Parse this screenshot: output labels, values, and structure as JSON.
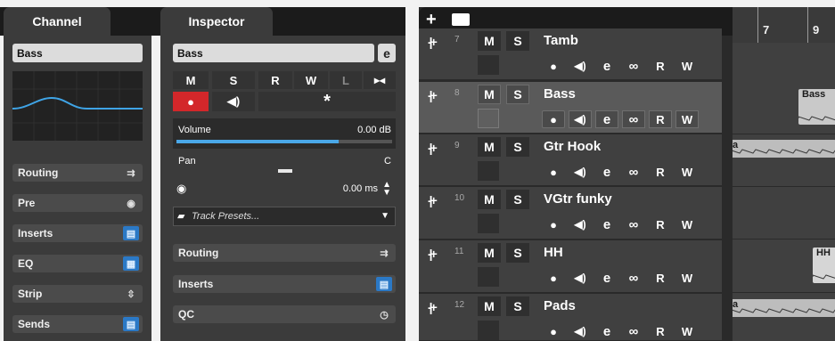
{
  "channel": {
    "tab_label": "Channel",
    "name": "Bass",
    "sections": [
      {
        "label": "Routing",
        "icon": "routing-icon"
      },
      {
        "label": "Pre",
        "icon": "pre-icon"
      },
      {
        "label": "Inserts",
        "icon": "inserts-icon"
      },
      {
        "label": "EQ",
        "icon": "eq-icon"
      },
      {
        "label": "Strip",
        "icon": "strip-icon"
      },
      {
        "label": "Sends",
        "icon": "sends-icon"
      }
    ]
  },
  "inspector": {
    "tab_label": "Inspector",
    "track_name": "Bass",
    "buttons": {
      "mute": "M",
      "solo": "S",
      "read": "R",
      "write": "W",
      "lanes": "L",
      "asterisk": "*"
    },
    "volume_label": "Volume",
    "volume_value": "0.00 dB",
    "volume_level": 0.75,
    "pan_label": "Pan",
    "pan_value": "C",
    "delay_value": "0.00 ms",
    "presets_placeholder": "Track Presets...",
    "sections": [
      {
        "label": "Routing",
        "icon": "routing-icon"
      },
      {
        "label": "Inserts",
        "icon": "inserts-icon"
      },
      {
        "label": "QC",
        "icon": "qc-icon"
      }
    ]
  },
  "tracklist": {
    "toolbar": {
      "add": "+",
      "folder": "folder-icon"
    },
    "tracks": [
      {
        "num": "7",
        "name": "Tamb",
        "mute": "M",
        "solo": "S",
        "read": "R",
        "write": "W",
        "selected": false,
        "record": false
      },
      {
        "num": "8",
        "name": "Bass",
        "mute": "M",
        "solo": "S",
        "read": "R",
        "write": "W",
        "selected": true,
        "record": true
      },
      {
        "num": "9",
        "name": "Gtr Hook",
        "mute": "M",
        "solo": "S",
        "read": "R",
        "write": "W",
        "selected": false,
        "record": false
      },
      {
        "num": "10",
        "name": "VGtr funky",
        "mute": "M",
        "solo": "S",
        "read": "R",
        "write": "W",
        "selected": false,
        "record": false
      },
      {
        "num": "11",
        "name": "HH",
        "mute": "M",
        "solo": "S",
        "read": "R",
        "write": "W",
        "selected": false,
        "record": false
      },
      {
        "num": "12",
        "name": "Pads",
        "mute": "M",
        "solo": "S",
        "read": "R",
        "write": "W",
        "selected": false,
        "record": false
      }
    ]
  },
  "timeline": {
    "ruler": [
      "7",
      "9"
    ],
    "clips": [
      {
        "label": "Bass",
        "color": "#c9c9c9"
      },
      {
        "label": "a",
        "color": "#bdbdbd"
      },
      {
        "label": "HH",
        "color": "#d6d6d6"
      },
      {
        "label": "a",
        "color": "#bdbdbd"
      }
    ]
  },
  "colors": {
    "record": "#d3272a",
    "accent_blue": "#2b79c6",
    "meter_blue": "#4aa8e8"
  }
}
